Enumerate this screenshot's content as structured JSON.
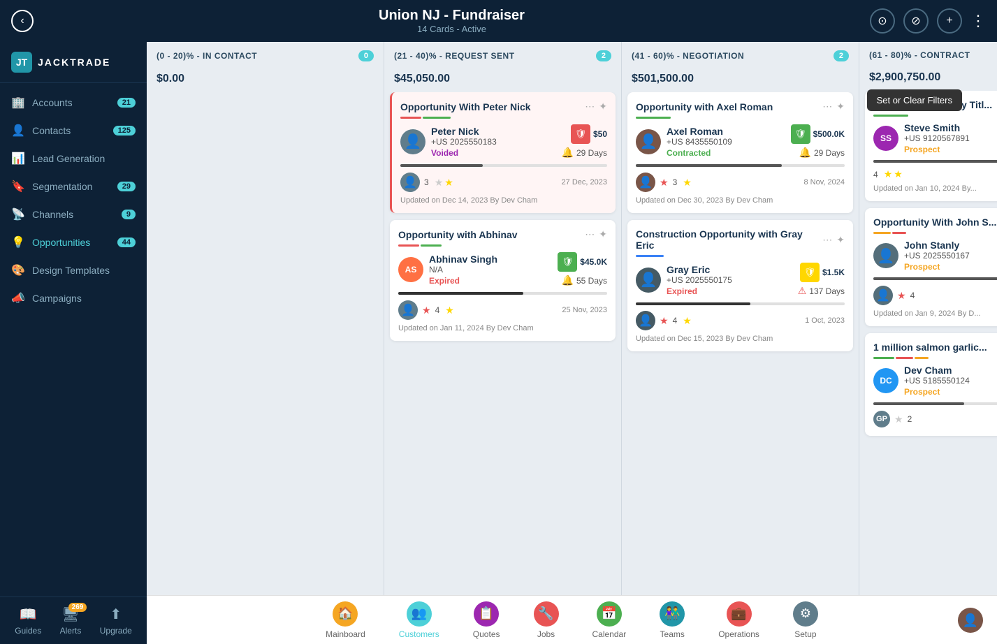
{
  "topBar": {
    "title": "Union NJ - Fundraiser",
    "subtitle": "14 Cards - Active",
    "backBtn": "‹",
    "searchIcon": "⊙",
    "filterIcon": "⊘",
    "addIcon": "+",
    "moreIcon": "⋮"
  },
  "sidebar": {
    "logo": "JT",
    "logoText": "JACKTRADE",
    "items": [
      {
        "id": "accounts",
        "label": "Accounts",
        "icon": "🏢",
        "badge": "21"
      },
      {
        "id": "contacts",
        "label": "Contacts",
        "icon": "👤",
        "badge": "125"
      },
      {
        "id": "lead-generation",
        "label": "Lead Generation",
        "icon": "📊",
        "badge": ""
      },
      {
        "id": "segmentation",
        "label": "Segmentation",
        "icon": "🔖",
        "badge": "29"
      },
      {
        "id": "channels",
        "label": "Channels",
        "icon": "📡",
        "badge": "9"
      },
      {
        "id": "opportunities",
        "label": "Opportunities",
        "icon": "💡",
        "badge": "44",
        "active": true
      },
      {
        "id": "design-templates",
        "label": "Design Templates",
        "icon": "🎨",
        "badge": ""
      },
      {
        "id": "campaigns",
        "label": "Campaigns",
        "icon": "📣",
        "badge": ""
      }
    ],
    "bottomBtns": [
      {
        "id": "guides",
        "label": "Guides",
        "icon": "📖"
      },
      {
        "id": "alerts",
        "label": "Alerts",
        "icon": "🖥",
        "badge": "269"
      },
      {
        "id": "upgrade",
        "label": "Upgrade",
        "icon": "⬆"
      }
    ]
  },
  "filterTooltip": "Set or Clear Filters",
  "columns": [
    {
      "id": "col1",
      "title": "(0 - 20)% - IN CONTACT",
      "badge": "0",
      "badgeColor": "teal",
      "amount": "$0.00",
      "cards": []
    },
    {
      "id": "col2",
      "title": "(21 - 40)% - REQUEST SENT",
      "badge": "2",
      "badgeColor": "teal",
      "amount": "$45,050.00",
      "cards": [
        {
          "id": "card1",
          "title": "Opportunity With Peter Nick",
          "highlighted": true,
          "colorBars": [
            "red",
            "green"
          ],
          "contactAvatar": "👤",
          "contactName": "Peter Nick",
          "contactPhone": "+US 2025550183",
          "contactStatus": "Voided",
          "statusClass": "voided",
          "shieldColor": "red",
          "amount": "$50",
          "days": "29 Days",
          "progress": 40,
          "footerAvatarSrc": "",
          "starCount": "3",
          "stars": [
            false,
            true,
            false
          ],
          "date": "27 Dec, 2023",
          "updated": "Updated on Dec 14, 2023 By Dev Cham"
        },
        {
          "id": "card2",
          "title": "Opportunity with Abhinav",
          "highlighted": false,
          "colorBars": [
            "red",
            "green"
          ],
          "contactAvatarText": "AS",
          "contactAvatarClass": "avatar-as",
          "contactName": "Abhinav Singh",
          "contactPhone": "N/A",
          "contactStatus": "Expired",
          "statusClass": "expired",
          "shieldColor": "green",
          "amount": "$45.0K",
          "days": "55 Days",
          "progress": 60,
          "starCount": "4",
          "stars": [
            true,
            true,
            false
          ],
          "starRed": true,
          "date": "25 Nov, 2023",
          "updated": "Updated on Jan 11, 2024 By Dev Cham"
        }
      ]
    },
    {
      "id": "col3",
      "title": "(41 - 60)% - NEGOTIATION",
      "badge": "2",
      "badgeColor": "teal",
      "amount": "$501,500.00",
      "cards": [
        {
          "id": "card3",
          "title": "Opportunity with Axel Roman",
          "highlighted": false,
          "colorBars": [
            "green"
          ],
          "contactAvatar": "👤",
          "contactName": "Axel Roman",
          "contactPhone": "+US 8435550109",
          "contactStatus": "Contracted",
          "statusClass": "contracted",
          "shieldColor": "green",
          "amount": "$500.0K",
          "days": "29 Days",
          "progress": 70,
          "starCount": "3",
          "stars": [
            false,
            true,
            false
          ],
          "starRed": true,
          "date": "8 Nov, 2024",
          "updated": "Updated on Dec 30, 2023 By Dev Cham"
        },
        {
          "id": "card4",
          "title": "Construction Opportunity with Gray Eric",
          "highlighted": false,
          "colorBars": [
            "blue"
          ],
          "contactAvatar": "👤",
          "contactName": "Gray Eric",
          "contactPhone": "+US 2025550175",
          "contactStatus": "Expired",
          "statusClass": "expired",
          "shieldColor": "yellow",
          "amount": "$1.5K",
          "days": "137 Days",
          "daysAlert": true,
          "progress": 55,
          "starCount": "4",
          "stars": [
            false,
            true,
            false
          ],
          "starRed": true,
          "date": "1 Oct, 2023",
          "updated": "Updated on Dec 15, 2023 By Dev Cham"
        }
      ]
    },
    {
      "id": "col4",
      "title": "(61 - 80)% - CONTRACT",
      "badge": "",
      "badgeColor": "",
      "amount": "$2,900,750.00",
      "cards": [
        {
          "id": "card5",
          "title": "Sample Opportunity Titl...",
          "highlighted": false,
          "colorBars": [
            "green"
          ],
          "contactAvatarText": "SS",
          "contactAvatarClass": "avatar-ss",
          "contactName": "Steve Smith",
          "contactPhone": "+US 9120567891",
          "contactStatus": "Prospect",
          "statusClass": "prospect",
          "shieldColor": "red",
          "isNew": true,
          "amount": "",
          "days": "",
          "progress": 80,
          "starCount": "4",
          "stars": [
            false,
            true,
            true
          ],
          "date": "",
          "updated": "Updated on Jan 10, 2024 By..."
        },
        {
          "id": "card6",
          "title": "Opportunity With John S...",
          "highlighted": false,
          "colorBars": [
            "orange",
            "red"
          ],
          "contactAvatar": "👤",
          "contactName": "John Stanly",
          "contactPhone": "+US 2025550167",
          "contactStatus": "Prospect",
          "statusClass": "prospect",
          "shieldColor": "green",
          "amount": "",
          "days": "",
          "progress": 70,
          "starCount": "4",
          "stars": [
            true,
            false,
            false
          ],
          "starRed": true,
          "date": "",
          "updated": "Updated on Jan 9, 2024 By D..."
        },
        {
          "id": "card7",
          "title": "1 million salmon garlic...",
          "highlighted": false,
          "colorBars": [
            "green",
            "red",
            "orange"
          ],
          "contactAvatarText": "DC",
          "contactAvatarClass": "avatar-dc",
          "contactName": "Dev Cham",
          "contactPhone": "+US 5185550124",
          "contactStatus": "Prospect",
          "statusClass": "prospect",
          "amount": "",
          "days": "",
          "progress": 50,
          "starCount": "2",
          "stars": [
            false,
            false,
            false
          ],
          "date": "",
          "updated": ""
        }
      ]
    }
  ],
  "bottomNav": {
    "tabs": [
      {
        "id": "mainboard",
        "label": "Mainboard",
        "icon": "🏠"
      },
      {
        "id": "customers",
        "label": "Customers",
        "icon": "👥",
        "active": true
      },
      {
        "id": "quotes",
        "label": "Quotes",
        "icon": "📋"
      },
      {
        "id": "jobs",
        "label": "Jobs",
        "icon": "🔧"
      },
      {
        "id": "calendar",
        "label": "Calendar",
        "icon": "📅"
      },
      {
        "id": "teams",
        "label": "Teams",
        "icon": "👫"
      },
      {
        "id": "operations",
        "label": "Operations",
        "icon": "💼"
      },
      {
        "id": "setup",
        "label": "Setup",
        "icon": "⚙"
      }
    ]
  }
}
